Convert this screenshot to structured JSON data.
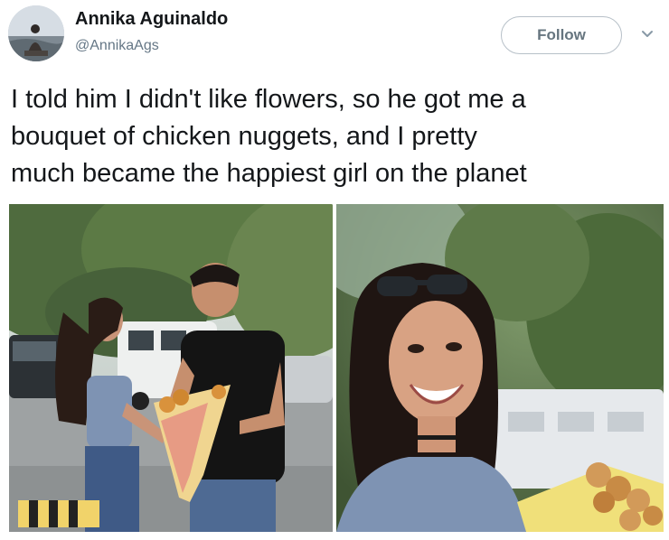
{
  "author": {
    "display_name": "Annika Aguinaldo",
    "handle": "@AnnikaAgs",
    "avatar_icon": "profile-photo"
  },
  "actions": {
    "follow_label": "Follow",
    "more_icon": "chevron-down-icon"
  },
  "tweet": {
    "text_lines": [
      "I told him I didn't like flowers, so he got me a",
      "bouquet of chicken nuggets, and I pretty",
      "much became the happiest girl on the planet"
    ]
  },
  "media": {
    "photo_count": 2
  },
  "colors": {
    "text": "#14171a",
    "secondary": "#657786",
    "border": "#b7c0c8"
  }
}
